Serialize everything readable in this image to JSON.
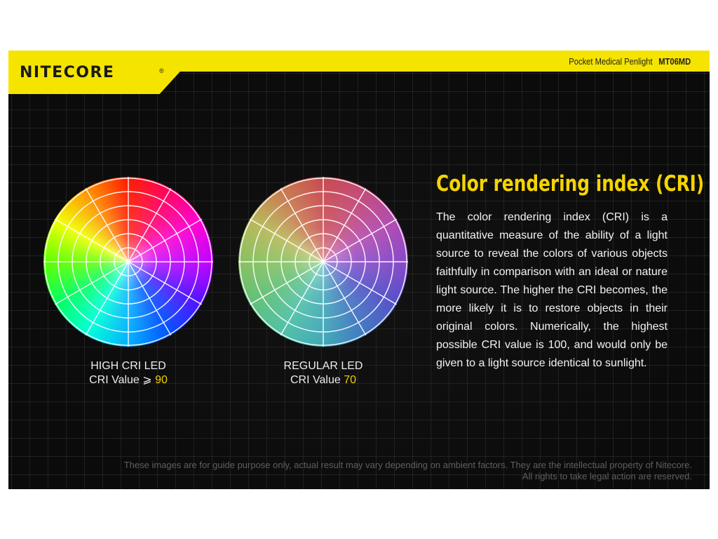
{
  "header": {
    "brand": "NITECORE",
    "registered_mark": "®",
    "product_name": "Pocket Medical Penlight",
    "model": "MT06MD"
  },
  "left_wheel": {
    "caption_line1": "HIGH CRI LED",
    "caption_prefix": "CRI Value ⩾ ",
    "caption_value": "90"
  },
  "right_wheel": {
    "caption_line1": "REGULAR LED",
    "caption_prefix": "CRI Value ",
    "caption_value": "70"
  },
  "content": {
    "title": "Color rendering index (CRI)",
    "body": "The color rendering index (CRI) is a quantitative measure of the ability of a light source to reveal the colors of various objects faithfully in comparison with an ideal or nature light source. The higher the CRI becomes, the more likely it is to restore objects in their original colors. Numerically, the highest possible CRI value is 100, and would only be given to a light source identical to sunlight."
  },
  "footer": {
    "disclaimer_line1": "These images are for guide purpose only, actual result may vary depending on ambient factors. They are the intellectual property of Nitecore.",
    "disclaimer_line2": "All rights to take legal action are reserved."
  },
  "colors": {
    "brand_yellow": "#f5e400",
    "title_yellow": "#f5d400",
    "value_yellow": "#f2d000"
  }
}
